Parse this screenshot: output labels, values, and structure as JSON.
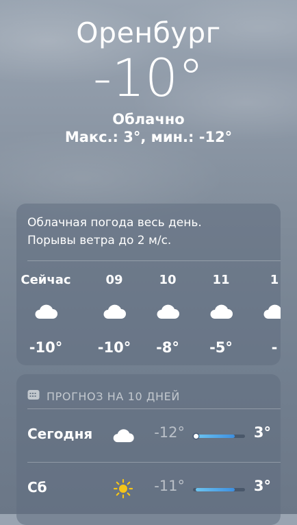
{
  "location": {
    "city": "Оренбург",
    "temperature": "-10°",
    "condition": "Облачно",
    "minmax": "Макс.: 3°, мин.: -12°"
  },
  "hourly": {
    "summary_line1": "Облачная погода весь день.",
    "summary_line2": "Порывы ветра до 2 м/с.",
    "hours": [
      {
        "label": "Сейчас",
        "icon": "cloud-icon",
        "temp": "-10°"
      },
      {
        "label": "09",
        "icon": "cloud-icon",
        "temp": "-10°"
      },
      {
        "label": "10",
        "icon": "cloud-icon",
        "temp": "-8°"
      },
      {
        "label": "11",
        "icon": "cloud-icon",
        "temp": "-5°"
      },
      {
        "label": "1",
        "icon": "cloud-icon",
        "temp": "-"
      }
    ]
  },
  "daily": {
    "header": "ПРОГНОЗ НА 10 ДНЕЙ",
    "header_icon": "calendar-icon",
    "days": [
      {
        "name": "Сегодня",
        "icon": "cloud-icon",
        "low": "-12°",
        "high": "3°",
        "bar_start": 0.05,
        "bar_end": 0.8,
        "current": 0.05
      },
      {
        "name": "Сб",
        "icon": "sun-icon",
        "low": "-11°",
        "high": "3°",
        "bar_start": 0.05,
        "bar_end": 0.8
      }
    ]
  },
  "colors": {
    "bar_cold": "#6cc4f0",
    "bar_warm": "#3d8fe0",
    "sun": "#f5c518"
  }
}
